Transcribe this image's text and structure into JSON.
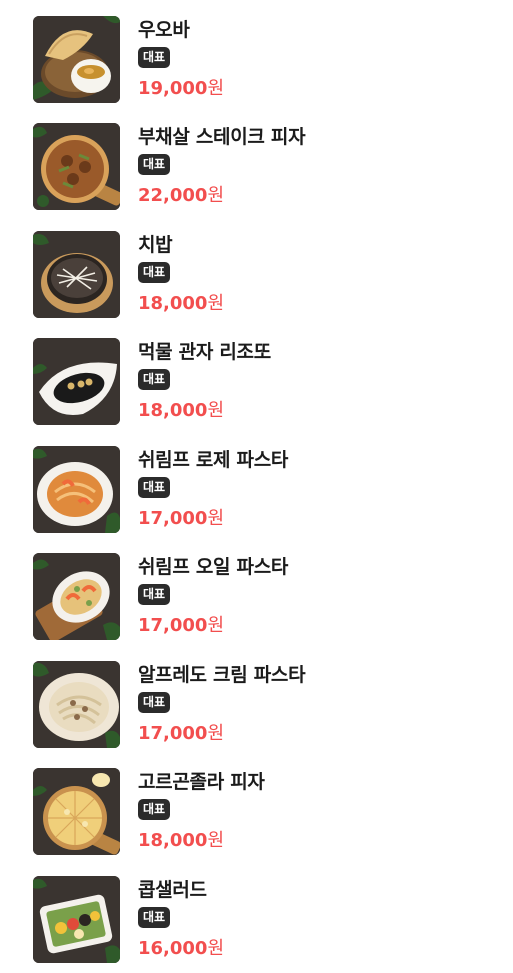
{
  "menu": {
    "items": [
      {
        "name": "우오바",
        "badge": "대표",
        "price": "19,000",
        "unit": "원",
        "image": "egg-dish-with-bread",
        "plate": "#f2f0ea",
        "food": "#c7902e",
        "accent": "#e9b45a"
      },
      {
        "name": "부채살 스테이크 피자",
        "badge": "대표",
        "price": "22,000",
        "unit": "원",
        "image": "steak-pizza",
        "plate": "#d9a25a",
        "food": "#8a4a22",
        "accent": "#6b8a3a"
      },
      {
        "name": "치밥",
        "badge": "대표",
        "price": "18,000",
        "unit": "원",
        "image": "cheese-rice",
        "plate": "#c99a5c",
        "food": "#2b2521",
        "accent": "#f3efe6"
      },
      {
        "name": "먹물 관자 리조또",
        "badge": "대표",
        "price": "18,000",
        "unit": "원",
        "image": "squid-ink-risotto",
        "plate": "#f5f3ef",
        "food": "#1a1a1a",
        "accent": "#d9b66a"
      },
      {
        "name": "쉬림프 로제 파스타",
        "badge": "대표",
        "price": "17,000",
        "unit": "원",
        "image": "shrimp-rose-pasta",
        "plate": "#f4f1ec",
        "food": "#e08a3c",
        "accent": "#f5c07a"
      },
      {
        "name": "쉬림프 오일 파스타",
        "badge": "대표",
        "price": "17,000",
        "unit": "원",
        "image": "shrimp-oil-pasta",
        "plate": "#f4f1ec",
        "food": "#e6c27a",
        "accent": "#7aa04a"
      },
      {
        "name": "알프레도 크림 파스타",
        "badge": "대표",
        "price": "17,000",
        "unit": "원",
        "image": "alfredo-cream-pasta",
        "plate": "#efe6d6",
        "food": "#e9dcc0",
        "accent": "#8a6a4a"
      },
      {
        "name": "고르곤졸라 피자",
        "badge": "대표",
        "price": "18,000",
        "unit": "원",
        "image": "gorgonzola-pizza",
        "plate": "#c9924e",
        "food": "#f0cf7a",
        "accent": "#f7e7b0"
      },
      {
        "name": "콥샐러드",
        "badge": "대표",
        "price": "16,000",
        "unit": "원",
        "image": "cobb-salad",
        "plate": "#f4f1ec",
        "food": "#7aa04a",
        "accent": "#f2c23a"
      }
    ]
  }
}
